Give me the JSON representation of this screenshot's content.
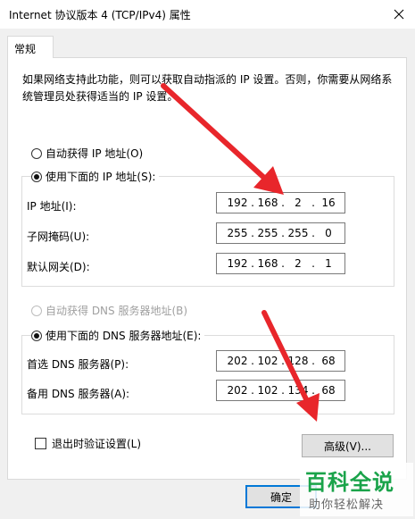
{
  "window": {
    "title": "Internet 协议版本 4 (TCP/IPv4) 属性",
    "close_icon": "close-icon"
  },
  "tabs": [
    {
      "label": "常规",
      "active": true
    }
  ],
  "description": "如果网络支持此功能，则可以获取自动指派的 IP 设置。否则，你需要从网络系统管理员处获得适当的 IP 设置。",
  "ip_section": {
    "auto_option": {
      "label": "自动获得 IP 地址(O)",
      "selected": false
    },
    "manual_option": {
      "label": "使用下面的 IP 地址(S):",
      "selected": true
    },
    "fields": [
      {
        "label": "IP 地址(I):",
        "octets": [
          "192",
          "168",
          "2",
          "16"
        ]
      },
      {
        "label": "子网掩码(U):",
        "octets": [
          "255",
          "255",
          "255",
          "0"
        ]
      },
      {
        "label": "默认网关(D):",
        "octets": [
          "192",
          "168",
          "2",
          "1"
        ]
      }
    ]
  },
  "dns_section": {
    "auto_option": {
      "label": "自动获得 DNS 服务器地址(B)",
      "selected": false,
      "disabled": true
    },
    "manual_option": {
      "label": "使用下面的 DNS 服务器地址(E):",
      "selected": true
    },
    "fields": [
      {
        "label": "首选 DNS 服务器(P):",
        "octets": [
          "202",
          "102",
          "128",
          "68"
        ]
      },
      {
        "label": "备用 DNS 服务器(A):",
        "octets": [
          "202",
          "102",
          "134",
          "68"
        ]
      }
    ]
  },
  "validate_checkbox": {
    "label": "退出时验证设置(L)",
    "checked": false
  },
  "buttons": {
    "advanced": "高级(V)...",
    "ok": "确定"
  },
  "annotation": {
    "arrow_color": "#e8262b"
  },
  "watermark": {
    "main": "百科全说",
    "sub": "助你轻松解决"
  }
}
